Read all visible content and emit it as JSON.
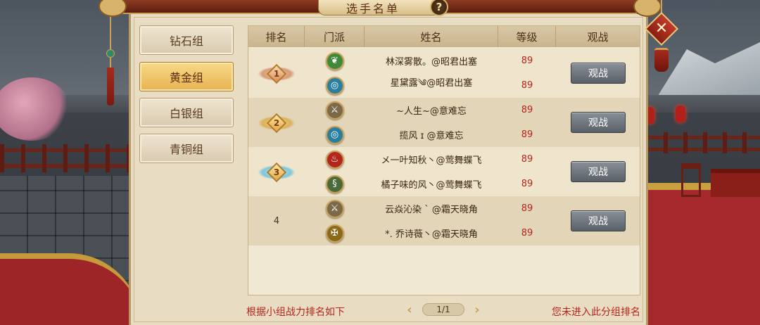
{
  "window": {
    "title": "选手名单",
    "help_label": "?",
    "close_label": "✕"
  },
  "tabs": [
    {
      "label": "钻石组",
      "active": false
    },
    {
      "label": "黄金组",
      "active": true
    },
    {
      "label": "白银组",
      "active": false
    },
    {
      "label": "青铜组",
      "active": false
    }
  ],
  "table": {
    "headers": [
      "排名",
      "门派",
      "姓名",
      "等级",
      "观战"
    ],
    "groups": [
      {
        "rank": "1",
        "rank_style": "bronze-gem",
        "watch_label": "观战",
        "players": [
          {
            "sect_icon": "leaf-sect-icon",
            "sect_color": "#3f8a3a",
            "name": "林深雾散。@昭君出塞",
            "level": "89"
          },
          {
            "sect_icon": "ring-sect-icon",
            "sect_color": "#2a7fa0",
            "name": "星黛露༄@昭君出塞",
            "level": "89"
          }
        ]
      },
      {
        "rank": "2",
        "rank_style": "gold-gem",
        "watch_label": "观战",
        "players": [
          {
            "sect_icon": "sword-sect-icon",
            "sect_color": "#7a6a4a",
            "name": "~人生~@意难忘",
            "level": "89"
          },
          {
            "sect_icon": "ring-sect-icon",
            "sect_color": "#2a7fa0",
            "name": "揽风 ɪ @意难忘",
            "level": "89"
          }
        ]
      },
      {
        "rank": "3",
        "rank_style": "blue-gem",
        "watch_label": "观战",
        "players": [
          {
            "sect_icon": "flame-sect-icon",
            "sect_color": "#b3261e",
            "name": "メ一叶知秋丶@莺舞蝶飞",
            "level": "89"
          },
          {
            "sect_icon": "snake-sect-icon",
            "sect_color": "#4a6a3a",
            "name": "橘子味的风丶@莺舞蝶飞",
            "level": "89"
          }
        ]
      },
      {
        "rank": "4",
        "rank_style": "plain",
        "watch_label": "观战",
        "players": [
          {
            "sect_icon": "sword-sect-icon",
            "sect_color": "#7a6a4a",
            "name": "云焱沁染 ` @霜天晓角",
            "level": "89"
          },
          {
            "sect_icon": "cross-sect-icon",
            "sect_color": "#8a6a1a",
            "name": "*. 乔诗薇丶@霜天晓角",
            "level": "89"
          }
        ]
      }
    ]
  },
  "footer": {
    "note_left": "根据小组战力排名如下",
    "note_right": "您未进入此分组排名",
    "page": "1/1",
    "prev_label": "‹",
    "next_label": "›"
  },
  "colors": {
    "level_red": "#b3261e",
    "active_tab": "#e8b250",
    "panel_bg": "#e8dcc2"
  }
}
